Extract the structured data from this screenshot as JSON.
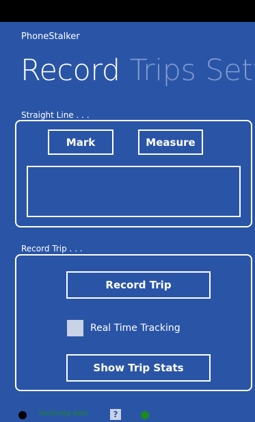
{
  "app": {
    "title": "PhoneStalker"
  },
  "pivot": {
    "items": [
      "Record",
      "Trips",
      "Settings"
    ]
  },
  "straight_line": {
    "label": "Straight Line . . .",
    "mark_label": "Mark",
    "measure_label": "Measure",
    "result_text": ""
  },
  "record_trip": {
    "label": "Record Trip . . .",
    "record_label": "Record Trip",
    "realtime_label": "Real Time Tracking",
    "realtime_checked": false,
    "stats_label": "Show Trip Stats"
  },
  "footer": {
    "status_text": "receiving data",
    "help_label": "?",
    "left_indicator_color": "#000000",
    "right_indicator_color": "#1a8c1a"
  }
}
